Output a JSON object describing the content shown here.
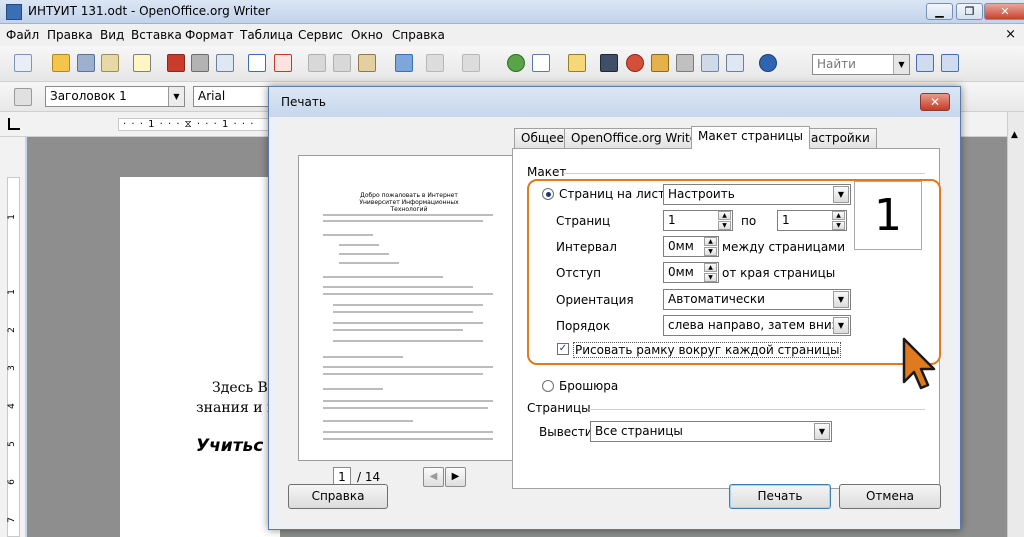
{
  "window": {
    "title": "ИНТУИТ 131.odt - OpenOffice.org Writer",
    "min_label": "▁",
    "max_label": "❐",
    "close_label": "✕"
  },
  "menu": {
    "items": [
      "Файл",
      "Правка",
      "Вид",
      "Вставка",
      "Формат",
      "Таблица",
      "Сервис",
      "Окно",
      "Справка"
    ],
    "close_glyph": "×"
  },
  "toolbar": {
    "find_placeholder": "Найти",
    "style_value": "Заголовок 1",
    "font_value": "Arial"
  },
  "ruler": {
    "marks": "· · · 1 · · · ⧖ · · · 1 · · ·",
    "vertical_numbers": [
      "1",
      "1",
      "2",
      "3",
      "4",
      "5",
      "6",
      "7"
    ]
  },
  "document": {
    "line1": "Здесь  Вы",
    "line2": "знания и п",
    "line3": "Учитьс"
  },
  "dialog": {
    "title": "Печать",
    "close_glyph": "✕",
    "preview": {
      "heading": "Добро пожаловать в Интернет Университет Информационных Технологий",
      "page_current": "1",
      "page_total": "/ 14"
    },
    "tabs": [
      "Общее",
      "OpenOffice.org Writer",
      "Макет страницы",
      "Настройки"
    ],
    "active_tab_index": 2,
    "layout": {
      "section_title": "Макет",
      "pages_per_sheet_label": "Страниц на лист",
      "pages_per_sheet_value": "Настроить",
      "pages_label": "Страниц",
      "pages_from": "1",
      "pages_by_label": "по",
      "pages_to": "1",
      "interval_label": "Интервал",
      "interval_value": "0мм",
      "interval_suffix": "между страницами",
      "indent_label": "Отступ",
      "indent_value": "0мм",
      "indent_suffix": "от края страницы",
      "orientation_label": "Ориентация",
      "orientation_value": "Автоматически",
      "order_label": "Порядок",
      "order_value": "слева направо, затем вниз",
      "border_label": "Рисовать рамку вокруг каждой страницы",
      "border_checked": true,
      "brochure_label": "Брошюра",
      "preview_number": "1"
    },
    "pages": {
      "section_title": "Страницы",
      "output_label": "Вывести",
      "output_value": "Все страницы"
    },
    "buttons": {
      "help": "Справка",
      "print": "Печать",
      "cancel": "Отмена"
    }
  },
  "colors": {
    "highlight": "#e07a1f",
    "dialog_bg": "#ecf1f8",
    "workspace": "#8e8e8e"
  }
}
